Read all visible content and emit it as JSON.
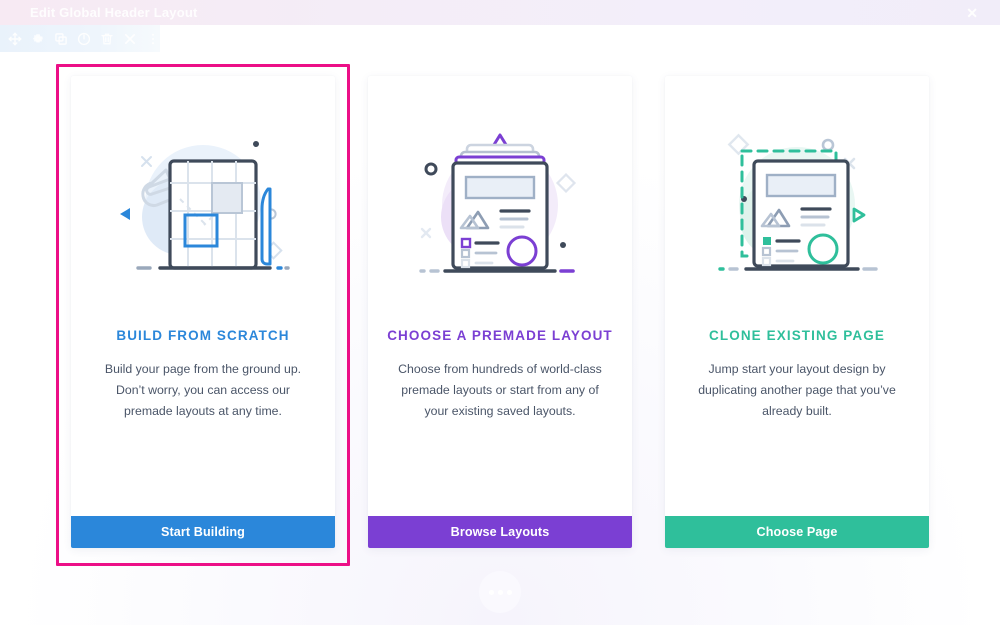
{
  "global_bar": {
    "title": "Edit Global Header Layout",
    "close_icon": "close-icon",
    "close_label": "✕"
  },
  "module_toolbar": {
    "icons": [
      {
        "name": "move-icon",
        "label": "Move"
      },
      {
        "name": "gear-icon",
        "label": "Settings"
      },
      {
        "name": "duplicate-icon",
        "label": "Duplicate"
      },
      {
        "name": "power-toggle-icon",
        "label": "Disable"
      },
      {
        "name": "trash-icon",
        "label": "Delete"
      },
      {
        "name": "close-icon",
        "label": "Close"
      },
      {
        "name": "more-options-icon",
        "label": "More Options"
      }
    ]
  },
  "colors": {
    "accent_pink": "#ec0f87",
    "blue": "#2b87da",
    "purple": "#7b3fd3",
    "teal": "#2fbf9b",
    "dark_outline": "#3f4a5a",
    "muted_text": "#4a5568"
  },
  "cards": [
    {
      "id": "build-from-scratch",
      "title": "BUILD FROM SCRATCH",
      "description": "Build your page from the ground up. Don’t worry, you can access our premade layouts at any time.",
      "button_label": "Start Building",
      "accent": "#2b87da",
      "selected": true,
      "illustration": "blueprint-grid-illustration"
    },
    {
      "id": "choose-premade-layout",
      "title": "CHOOSE A PREMADE LAYOUT",
      "description": "Choose from hundreds of world-class premade layouts or start from any of your existing saved layouts.",
      "button_label": "Browse Layouts",
      "accent": "#7b3fd3",
      "selected": false,
      "illustration": "stacked-pages-illustration"
    },
    {
      "id": "clone-existing-page",
      "title": "CLONE EXISTING PAGE",
      "description": "Jump start your layout design by duplicating another page that you’ve already built.",
      "button_label": "Choose Page",
      "accent": "#2fbf9b",
      "selected": false,
      "illustration": "clone-page-illustration"
    }
  ],
  "bottom_fab": {
    "name": "more-options-fab",
    "dots": 3
  }
}
